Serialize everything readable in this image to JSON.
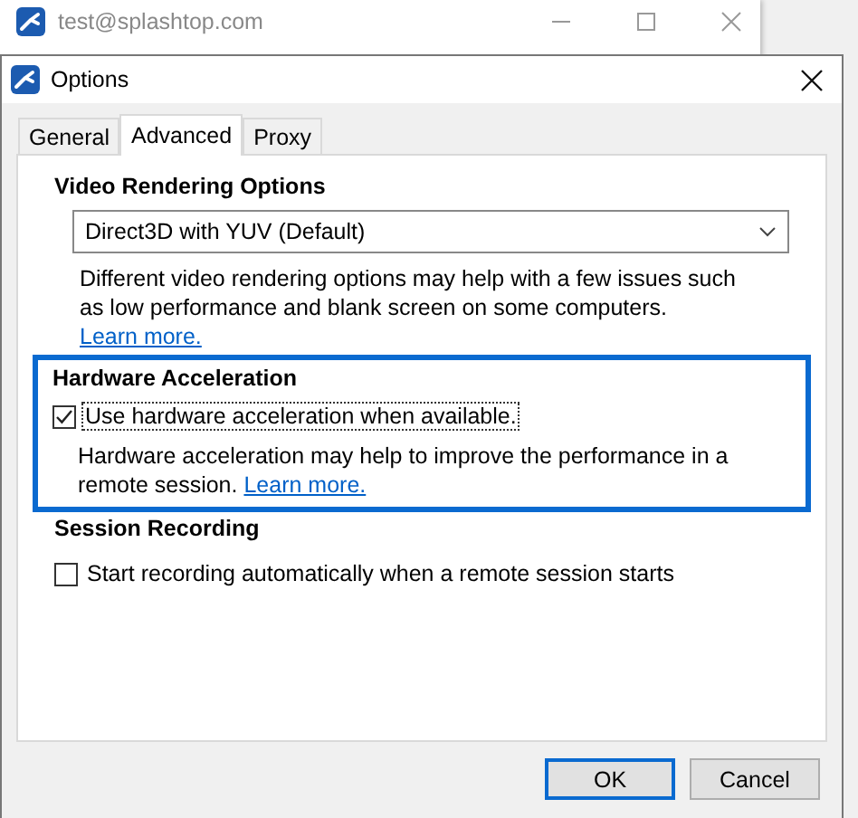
{
  "background_window": {
    "title": "test@splashtop.com"
  },
  "dialog": {
    "title": "Options"
  },
  "tabs": [
    {
      "label": "General",
      "selected": false
    },
    {
      "label": "Advanced",
      "selected": true
    },
    {
      "label": "Proxy",
      "selected": false
    }
  ],
  "sections": [
    {
      "heading": "Video Rendering Options",
      "highlighted": false,
      "kind": "dropdown",
      "value": "Direct3D with YUV (Default)",
      "description": "Different video rendering options may help with a few issues such as low performance and blank screen on some computers.",
      "link": "Learn more."
    },
    {
      "heading": "Hardware Acceleration",
      "highlighted": true,
      "kind": "checkbox",
      "label": "Use hardware acceleration when available.",
      "checked": true,
      "focused": true,
      "description": "Hardware acceleration may help to improve the performance in a remote session.",
      "link": "Learn more."
    },
    {
      "heading": "Session Recording",
      "highlighted": false,
      "kind": "checkbox",
      "label": "Start recording automatically when a remote session starts",
      "checked": false,
      "focused": false
    }
  ],
  "buttons": [
    {
      "label": "OK",
      "default": true
    },
    {
      "label": "Cancel",
      "default": false
    }
  ]
}
